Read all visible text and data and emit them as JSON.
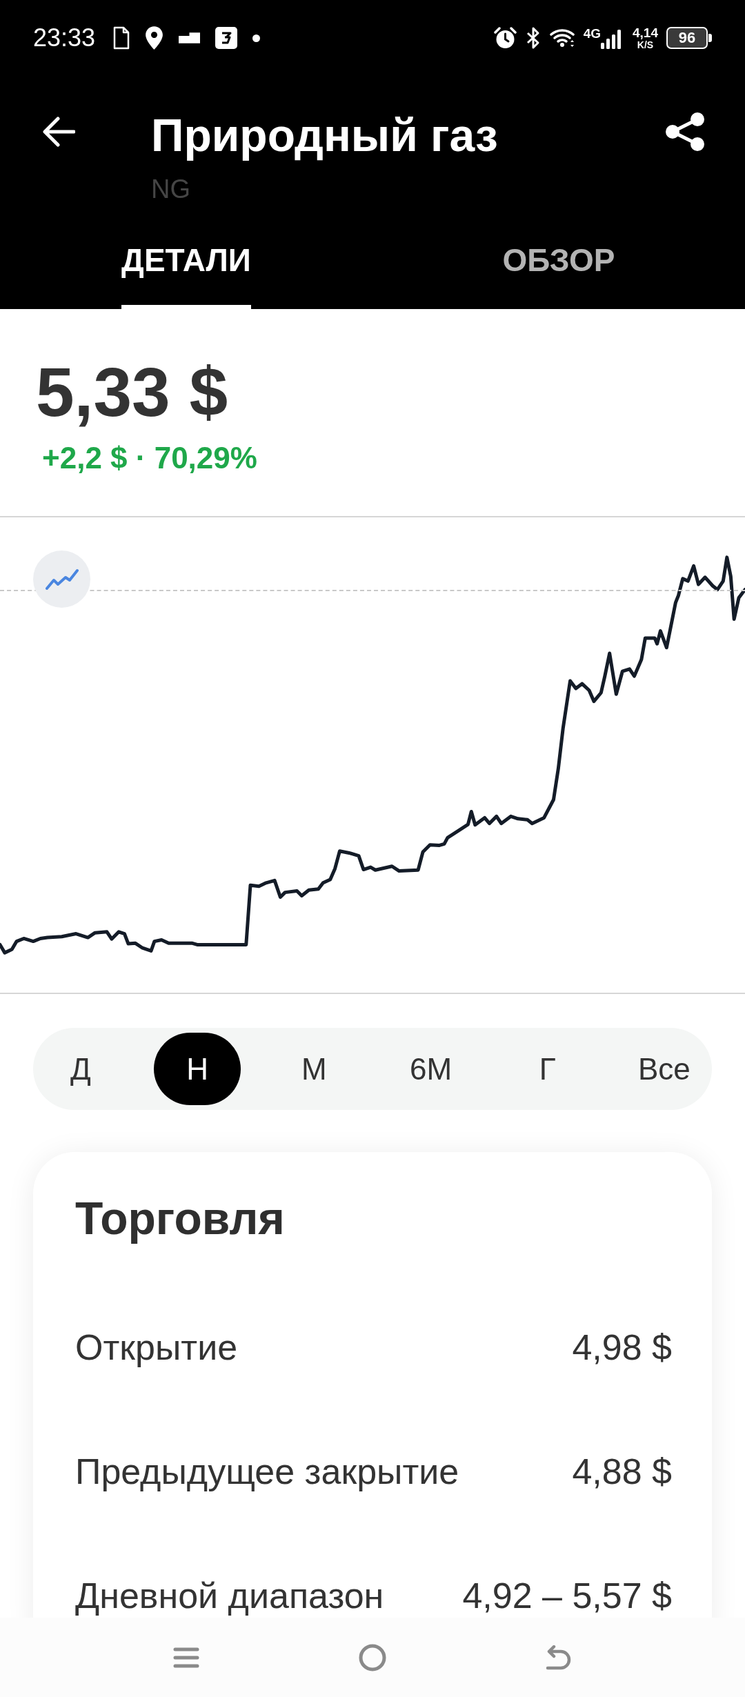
{
  "status_bar": {
    "time": "23:33",
    "network_type": "4G",
    "speed_value": "4,14",
    "speed_unit": "K/S",
    "battery": "96"
  },
  "app_bar": {
    "title": "Природный газ",
    "ticker": "NG"
  },
  "tabs": [
    {
      "label": "ДЕТАЛИ",
      "selected": true
    },
    {
      "label": "ОБЗОР",
      "selected": false
    }
  ],
  "quote": {
    "price": "5,33 $",
    "change": "+2,2 $ · 70,29%",
    "rising": true
  },
  "periods": [
    {
      "label": "Д",
      "selected": false
    },
    {
      "label": "Н",
      "selected": true
    },
    {
      "label": "М",
      "selected": false
    },
    {
      "label": "6М",
      "selected": false
    },
    {
      "label": "Г",
      "selected": false
    },
    {
      "label": "Все",
      "selected": false
    }
  ],
  "trading": {
    "title": "Торговля",
    "rows": [
      {
        "label": "Открытие",
        "value": "4,98 $"
      },
      {
        "label": "Предыдущее закрытие",
        "value": "4,88 $"
      },
      {
        "label": "Дневной диапазон",
        "value": "4,92 – 5,57 $"
      }
    ]
  }
}
